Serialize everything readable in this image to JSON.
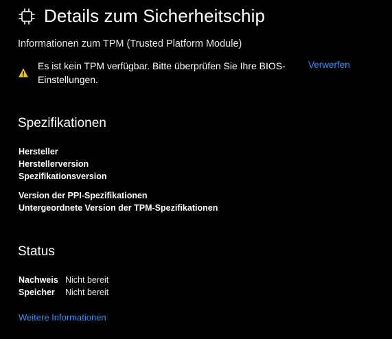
{
  "header": {
    "title": "Details zum Sicherheitschip",
    "icon": "chip-icon"
  },
  "subtitle": "Informationen zum TPM (Trusted Platform Module)",
  "warning": {
    "icon": "warning-icon",
    "icon_color": "#f2c10f",
    "message": "Es ist kein TPM verfügbar. Bitte überprüfen Sie Ihre BIOS-Einstellungen.",
    "dismiss_label": "Verwerfen"
  },
  "specifications": {
    "heading": "Spezifikationen",
    "group1": [
      "Hersteller",
      "Herstellerversion",
      "Spezifikationsversion"
    ],
    "group2": [
      "Version der PPI-Spezifikationen",
      "Untergeordnete Version der TPM-Spezifikationen"
    ]
  },
  "status": {
    "heading": "Status",
    "rows": [
      {
        "label": "Nachweis",
        "value": "Nicht bereit"
      },
      {
        "label": "Speicher",
        "value": "Nicht bereit"
      }
    ]
  },
  "more_info_link": "Weitere Informationen",
  "colors": {
    "background": "#000000",
    "accent_link": "#3d8ef0",
    "text": "#ffffff"
  }
}
